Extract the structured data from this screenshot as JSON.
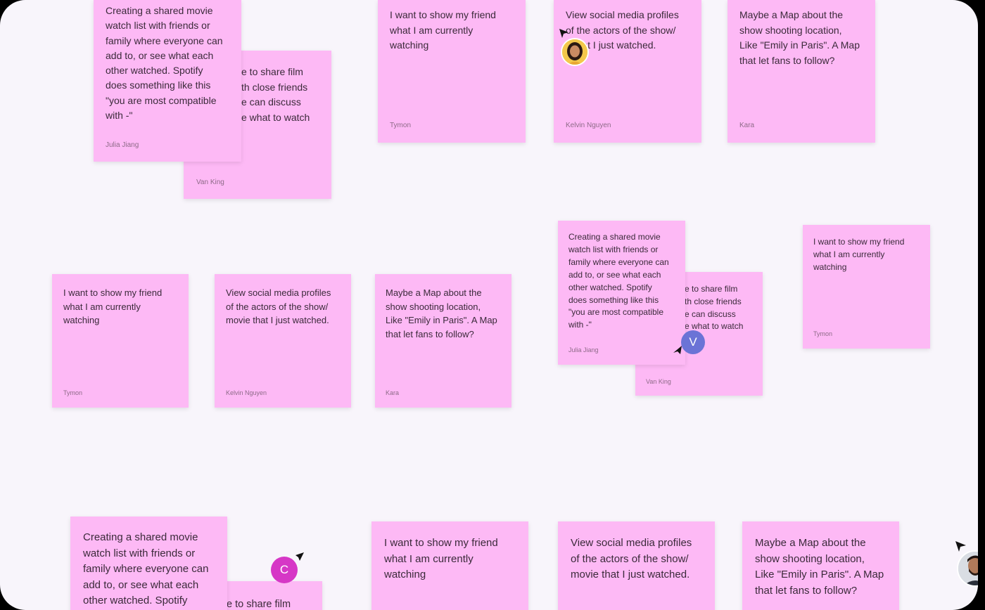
{
  "notes": {
    "shared_list": "Creating a shared movie\nwatch list with friends or\nfamily where everyone can\nadd to, or see what each\nother watched. Spotify\ndoes something like this\n\"you are most compatible\nwith -\"",
    "shared_list_bottom": "Creating a shared movie\nwatch list with friends or\nfamily where everyone can\nadd to, or see what each\nother watched. Spotify",
    "share_film": "e to share film\nth close friends\ne can discuss\ne what to watch",
    "share_film_right": "e to share film\nth close friends\ne can discuss\ne what to watch",
    "share_film_bottom": "e to share film",
    "show_friend": "I want to show my friend\nwhat I am currently\nwatching",
    "social_profiles": "View social media profiles\nof the actors of the show/\nmovie that I just watched.",
    "social_profiles_top": "View social media profiles\nof the actors of the show/\n     e that I just watched.",
    "map_location": "Maybe a Map about the\nshow shooting location,\nLike \"Emily in Paris\". A Map\nthat let fans to follow?"
  },
  "authors": {
    "julia": "Julia Jiang",
    "van": "Van King",
    "tymon": "Tymon",
    "kelvin": "Kelvin Nguyen",
    "kara": "Kara"
  },
  "collaborators": {
    "v_initial": "V",
    "c_initial": "C",
    "v_color": "#6b73d6",
    "c_color": "#d637c6"
  },
  "colors": {
    "note": "#fdb9f5",
    "canvas": "#f8f5fb"
  }
}
